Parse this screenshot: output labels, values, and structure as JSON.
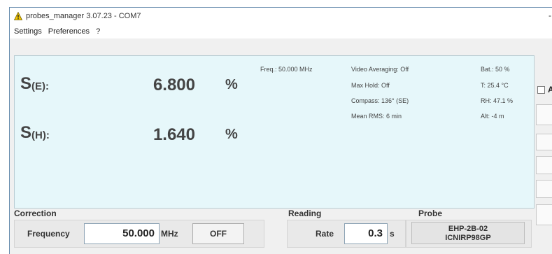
{
  "window": {
    "title": "probes_manager 3.07.23 - COM7",
    "control_glyph": "-"
  },
  "menu": [
    "Settings",
    "Preferences",
    "?"
  ],
  "display": {
    "se": {
      "label_main": "S",
      "label_sub": "(E):",
      "value": "6.800",
      "unit": "%"
    },
    "sh": {
      "label_main": "S",
      "label_sub": "(H):",
      "value": "1.640",
      "unit": "%"
    },
    "freq": "Freq.: 50.000 MHz",
    "video_averaging": "Video Averaging: Off",
    "max_hold": "Max Hold: Off",
    "compass": "Compass: 136° (SE)",
    "mean_rms": "Mean RMS: 6 min",
    "battery": "Bat.: 50 %",
    "temperature": "T: 25.4 °C",
    "humidity": "RH: 47.1 %",
    "altitude": "Alt: -4 m"
  },
  "right_panel": {
    "checkbox_letter": "A"
  },
  "correction": {
    "title": "Correction",
    "frequency_label": "Frequency",
    "frequency_value": "50.000",
    "frequency_unit": "MHz",
    "off_button": "OFF"
  },
  "reading": {
    "title": "Reading",
    "rate_label": "Rate",
    "rate_value": "0.3",
    "rate_unit": "s"
  },
  "probe": {
    "title": "Probe",
    "model_line1": "EHP-2B-02",
    "model_line2": "ICNIRP98GP"
  },
  "colors": {
    "display_background": "#e6f7fa",
    "window_background": "#f0f0f0",
    "warning_icon": "#f2c500"
  },
  "icons": {
    "app": "warning-triangle-icon"
  }
}
